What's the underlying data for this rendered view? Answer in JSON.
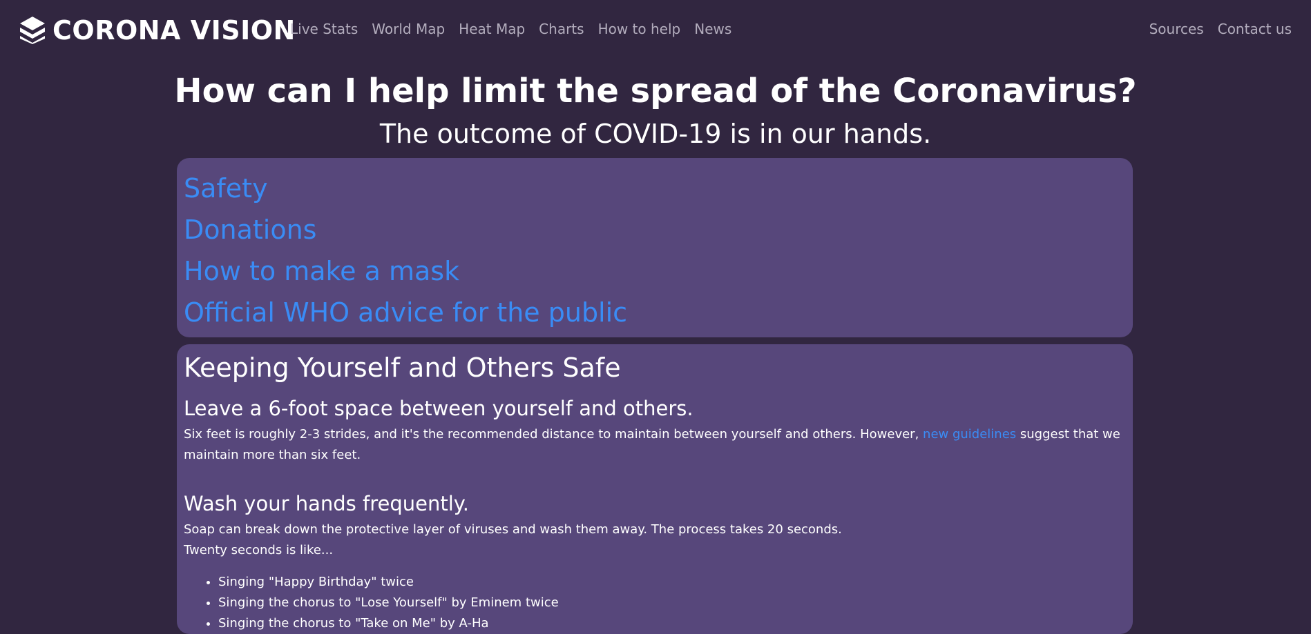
{
  "nav": {
    "brand": "CORONA VISION",
    "brand_icon": "layers-logo-icon",
    "links": [
      "Live Stats",
      "World Map",
      "Heat Map",
      "Charts",
      "How to help",
      "News"
    ],
    "right_links": [
      "Sources",
      "Contact us"
    ]
  },
  "header": {
    "title": "How can I help limit the spread of the Coronavirus?",
    "subtitle": "The outcome of COVID-19 is in our hands."
  },
  "toc": {
    "items": [
      "Safety",
      "Donations",
      "How to make a mask",
      "Official WHO advice for the public"
    ]
  },
  "safety": {
    "heading": "Keeping Yourself and Others Safe",
    "distance": {
      "heading": "Leave a 6-foot space between yourself and others.",
      "text_before": "Six feet is roughly 2-3 strides, and it's the recommended distance to maintain between yourself and others. However,",
      "link": "new guidelines",
      "text_after": "suggest that we maintain more than six feet."
    },
    "wash": {
      "heading": "Wash your hands frequently.",
      "line1": "Soap can break down the protective layer of viruses and wash them away. The process takes 20 seconds.",
      "line2": "Twenty seconds is like...",
      "items": [
        "Singing \"Happy Birthday\" twice",
        "Singing the chorus to \"Lose Yourself\" by Eminem twice",
        "Singing the chorus to \"Take on Me\" by A-Ha"
      ]
    }
  },
  "colors": {
    "background": "#312640",
    "card": "#57477b",
    "link": "#3a8cf5",
    "nav_link": "#b3adbd"
  }
}
